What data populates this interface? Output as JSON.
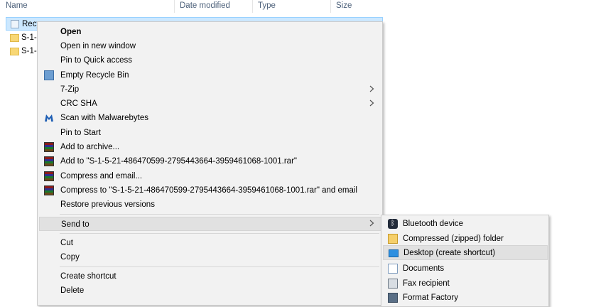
{
  "columns": {
    "name": "Name",
    "date_modified": "Date modified",
    "type": "Type",
    "size": "Size"
  },
  "files": [
    {
      "name": "Recy",
      "icon": "recycle-bin-icon",
      "selected": true
    },
    {
      "name": "S-1-",
      "icon": "folder-icon",
      "selected": false
    },
    {
      "name": "S-1-",
      "icon": "folder-icon",
      "selected": false
    }
  ],
  "context_menu": {
    "items": [
      {
        "label": "Open",
        "bold": true
      },
      {
        "label": "Open in new window"
      },
      {
        "label": "Pin to Quick access"
      },
      {
        "label": "Empty Recycle Bin",
        "icon": "recycle-bin-icon"
      },
      {
        "label": "7-Zip",
        "submenu": true
      },
      {
        "label": "CRC SHA",
        "submenu": true
      },
      {
        "label": "Scan with Malwarebytes",
        "icon": "malwarebytes-icon"
      },
      {
        "label": "Pin to Start"
      },
      {
        "label": "Add to archive...",
        "icon": "winrar-icon"
      },
      {
        "label": "Add to \"S-1-5-21-486470599-2795443664-3959461068-1001.rar\"",
        "icon": "winrar-icon"
      },
      {
        "label": "Compress and email...",
        "icon": "winrar-icon"
      },
      {
        "label": "Compress to \"S-1-5-21-486470599-2795443664-3959461068-1001.rar\" and email",
        "icon": "winrar-icon"
      },
      {
        "label": "Restore previous versions"
      },
      {
        "label": "Send to",
        "submenu": true,
        "highlighted": true
      },
      {
        "label": "Cut"
      },
      {
        "label": "Copy"
      },
      {
        "label": "Create shortcut"
      },
      {
        "label": "Delete"
      }
    ]
  },
  "send_to_menu": {
    "items": [
      {
        "label": "Bluetooth device",
        "icon": "bluetooth-icon"
      },
      {
        "label": "Compressed (zipped) folder",
        "icon": "zip-folder-icon"
      },
      {
        "label": "Desktop (create shortcut)",
        "icon": "desktop-icon",
        "highlighted": true
      },
      {
        "label": "Documents",
        "icon": "documents-icon"
      },
      {
        "label": "Fax recipient",
        "icon": "fax-icon"
      },
      {
        "label": "Format Factory",
        "icon": "format-factory-icon"
      }
    ]
  },
  "colors": {
    "header_text": "#4c607a",
    "selection_bg": "#cce8ff",
    "menu_bg": "#f2f2f2",
    "menu_highlight": "#e1e1e1"
  }
}
